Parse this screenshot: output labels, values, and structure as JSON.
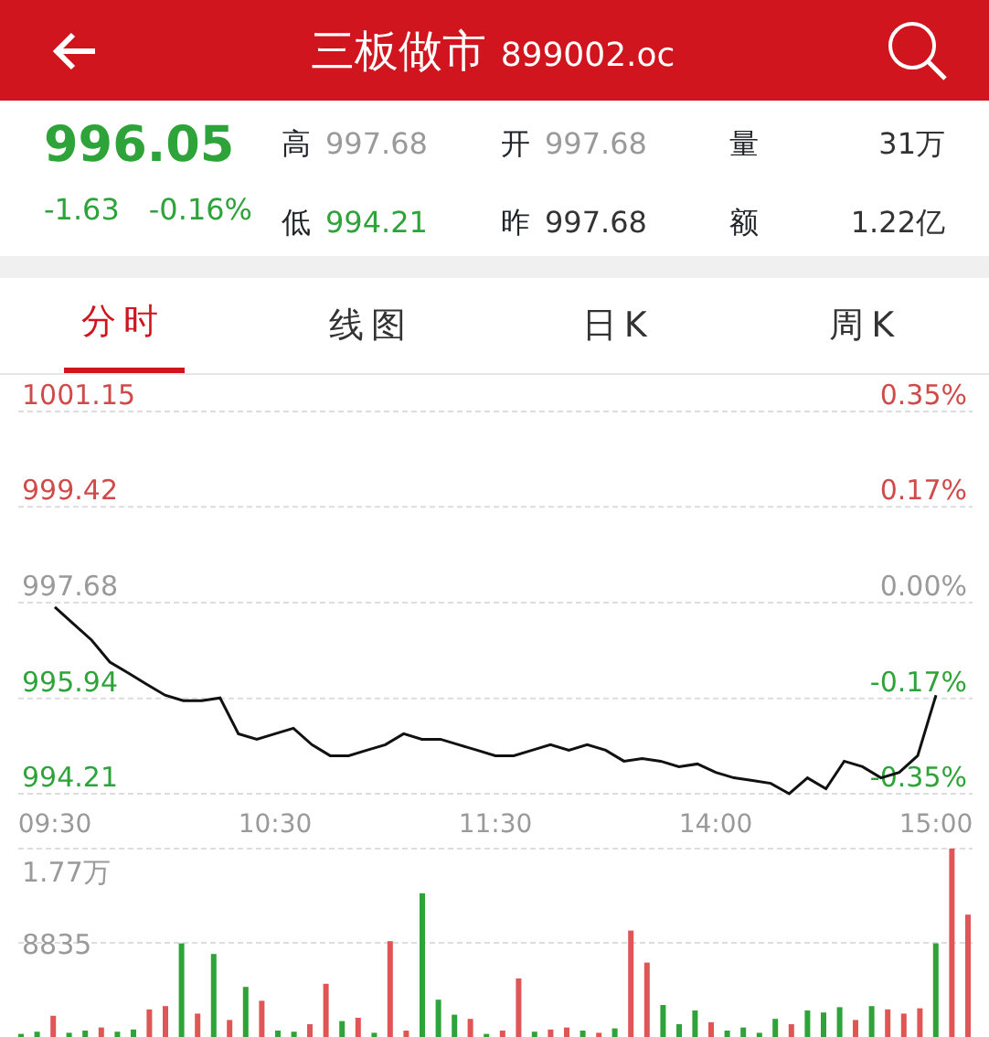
{
  "header": {
    "title": "三板做市",
    "code": "899002.oc"
  },
  "quote": {
    "price": "996.05",
    "change": "-1.63",
    "change_pct": "-0.16%",
    "color": "#2ea33a",
    "stats": [
      {
        "label": "高",
        "value": "997.68",
        "color": "#9a9a9a"
      },
      {
        "label": "开",
        "value": "997.68",
        "color": "#9a9a9a"
      },
      {
        "label": "量",
        "value": "31万",
        "color": "#333333"
      },
      {
        "label": "低",
        "value": "994.21",
        "color": "#2ea33a"
      },
      {
        "label": "昨",
        "value": "997.68",
        "color": "#333333"
      },
      {
        "label": "额",
        "value": "1.22亿",
        "color": "#333333"
      }
    ]
  },
  "tabs": [
    {
      "label": "分时",
      "selected": true
    },
    {
      "label": "线图",
      "selected": false
    },
    {
      "label": "日K",
      "selected": false
    },
    {
      "label": "周K",
      "selected": false
    }
  ],
  "price_chart": {
    "left_label_colors": [
      {
        "color": "#d04a4a"
      },
      {
        "color": "#d04a4a"
      },
      {
        "color": "#9a9a9a"
      },
      {
        "color": "#2ea33a"
      },
      {
        "color": "#2ea33a"
      }
    ],
    "right_labels": [
      {
        "label": "0.35%",
        "color": "#d04a4a"
      },
      {
        "label": "0.17%",
        "color": "#d04a4a"
      },
      {
        "label": "0.00%",
        "color": "#9a9a9a"
      },
      {
        "label": "-0.17%",
        "color": "#2ea33a"
      },
      {
        "label": "-0.35%",
        "color": "#2ea33a"
      }
    ],
    "chart_data": {
      "type": "line",
      "grid": true,
      "categories": [
        "09:30",
        null,
        null,
        null,
        null,
        null,
        null,
        null,
        null,
        null,
        null,
        null,
        "10:30",
        null,
        null,
        null,
        null,
        null,
        null,
        null,
        null,
        null,
        null,
        null,
        "11:30",
        null,
        null,
        null,
        null,
        null,
        null,
        null,
        null,
        null,
        null,
        null,
        "14:00",
        null,
        null,
        null,
        null,
        null,
        null,
        null,
        null,
        null,
        null,
        null,
        "15:00"
      ],
      "series": [
        {
          "color": "#111111",
          "values": [
            997.6,
            997.3,
            997.0,
            996.6,
            996.4,
            996.2,
            996.0,
            995.9,
            995.9,
            995.95,
            995.3,
            995.2,
            995.3,
            995.4,
            995.1,
            994.9,
            994.9,
            995.0,
            995.1,
            995.3,
            995.2,
            995.2,
            995.1,
            995.0,
            994.9,
            994.9,
            995.0,
            995.1,
            995.0,
            995.1,
            995.0,
            994.8,
            994.85,
            994.8,
            994.7,
            994.75,
            994.6,
            994.5,
            994.45,
            994.4,
            994.21,
            994.5,
            994.3,
            994.8,
            994.7,
            994.5,
            994.6,
            994.9,
            996.0
          ]
        }
      ],
      "ylim": [
        994.21,
        1001.15
      ],
      "yticks": [
        {
          "value": 1001.15,
          "label": "1001.15"
        },
        {
          "value": 999.42,
          "label": "999.42"
        },
        {
          "value": 997.68,
          "label": "997.68"
        },
        {
          "value": 995.94,
          "label": "995.94"
        },
        {
          "value": 994.21,
          "label": "994.21"
        }
      ]
    }
  },
  "volume_chart": {
    "axis_labels": [
      {
        "label": "1.77万"
      },
      {
        "label": "8835"
      }
    ]
  }
}
